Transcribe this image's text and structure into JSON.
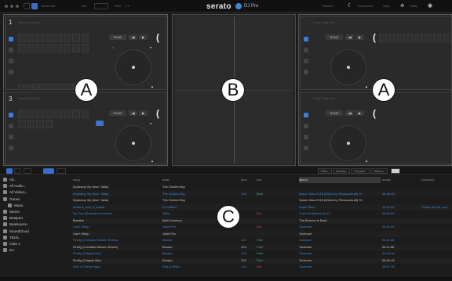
{
  "app": {
    "logo": "serato",
    "logo_suffix": "DJ Pro"
  },
  "topbar": {
    "mode_label": "Horizontal",
    "items": [
      "Link",
      "REC",
      "FX"
    ],
    "right_items": [
      "Practice",
      "Exclusions",
      "Help",
      "Setup"
    ]
  },
  "decks": {
    "left_top": {
      "number": "1",
      "title": "Drag Song Here"
    },
    "left_bottom": {
      "number": "3",
      "title": "Drag Song Here"
    },
    "right_top": {
      "title": "Drag Song Here"
    },
    "right_bottom": {
      "title": "Drag Song Here"
    },
    "sync_label": "SYNC",
    "play_glyph": "▶",
    "cue_glyph": "|◀",
    "x_glyph": "✕"
  },
  "labels": {
    "a_left": "A",
    "b": "B",
    "a_right": "A",
    "c": "C"
  },
  "library": {
    "panel_tabs": [
      "Files",
      "Browse",
      "Prepare",
      "History"
    ],
    "sidebar": [
      {
        "label": "All...",
        "icon": "star-icon"
      },
      {
        "label": "All Audio...",
        "icon": "audio-icon"
      },
      {
        "label": "All Videos...",
        "icon": "video-icon"
      },
      {
        "label": "iTunes",
        "icon": "itunes-icon"
      },
      {
        "label": "Music",
        "icon": "music-icon"
      },
      {
        "label": "Stems",
        "icon": "stems-icon"
      },
      {
        "label": "Beatport",
        "icon": "beatport-icon"
      },
      {
        "label": "Beatsource",
        "icon": "beatsource-icon"
      },
      {
        "label": "SoundCloud",
        "icon": "soundcloud-icon"
      },
      {
        "label": "TIDAL",
        "icon": "tidal-icon"
      },
      {
        "label": "crate 1",
        "icon": "crate-icon"
      },
      {
        "label": "DA",
        "icon": "crate-icon"
      }
    ],
    "columns": [
      "song",
      "artist",
      "bpm",
      "key",
      "album",
      "length",
      "comment"
    ],
    "rows": [
      {
        "song": "Epiphany Vip (feat. Taliia)",
        "artist": "The Golden Boy",
        "bpm": "",
        "key": "",
        "album": "",
        "length": "",
        "comment": "",
        "color": "#c8c8c8"
      },
      {
        "song": "Epiphany Vip (feat. Taliia)",
        "artist": "The Golden Boy",
        "bpm": "124",
        "key": "Ebm",
        "album": "Space Ibiza 2015 (Mixed by Pleasurekraft) Te",
        "length": "05:48.45",
        "comment": "",
        "color": "#3a8be0"
      },
      {
        "song": "Epiphany Vip (feat. Taliia)",
        "artist": "The Golden Boy",
        "bpm": "",
        "key": "",
        "album": "Space Ibiza 2015 (Mixed by Pleasurekraft) Te",
        "length": "",
        "comment": "",
        "color": "#c8c8c8"
      },
      {
        "song": "seabird_solo_a_teaser",
        "artist": "DJ Gilbert",
        "bpm": "",
        "key": "",
        "album": "Super Best",
        "length": "12:19.84",
        "comment": "Thank you for your",
        "color": "#3a8be0"
      },
      {
        "song": "My Turn (Extended Version)",
        "artist": "Taliia",
        "bpm": "",
        "key": "Em",
        "album": "That's Enriched Vol.12",
        "length": "06:02.69",
        "comment": "",
        "color": "#3a8be0"
      },
      {
        "song": "Breathe",
        "artist": "Brett Johnson",
        "bpm": "",
        "key": "",
        "album": "The Bounce Is Back",
        "length": "",
        "comment": "",
        "color": "#c8c8c8"
      },
      {
        "song": "Can't Sleep",
        "artist": "Juliet Fox",
        "bpm": "",
        "key": "Dm",
        "album": "Toolroom",
        "length": "06:21.69",
        "comment": "",
        "color": "#3a8be0"
      },
      {
        "song": "Can't Sleep",
        "artist": "Juliet Fox",
        "bpm": "",
        "key": "",
        "album": "Toolroom",
        "length": "",
        "comment": "",
        "color": "#c8c8c8"
      },
      {
        "song": "Firefly (Christian Nielsen Remix)",
        "artist": "Bontan",
        "bpm": "124",
        "key": "F#m",
        "album": "Toolroom",
        "length": "06:11.85",
        "comment": "",
        "color": "#3a8be0"
      },
      {
        "song": "Firefly (Christian Nielsen Remix)",
        "artist": "Bontan",
        "bpm": "124",
        "key": "F#m",
        "album": "Toolroom",
        "length": "06:11.85",
        "comment": "",
        "color": "#c8c8c8"
      },
      {
        "song": "Firefly (Original Mix)",
        "artist": "Bontan",
        "bpm": "123",
        "key": "F#m",
        "album": "Toolroom",
        "length": "06:06.18",
        "comment": "",
        "color": "#3a8be0"
      },
      {
        "song": "Firefly (Original Mix)",
        "artist": "Bontan",
        "bpm": "123",
        "key": "F#m",
        "album": "Toolroom",
        "length": "06:06.18",
        "comment": "",
        "color": "#c8c8c8"
      },
      {
        "song": "One of These Days",
        "artist": "Pink & Ritch",
        "bpm": "124",
        "key": "Dm",
        "album": "Toolroom",
        "length": "05:57.15",
        "comment": "",
        "color": "#3a8be0"
      }
    ]
  },
  "colors": {
    "accent": "#3a7fe0",
    "key_red": "#d24a4a",
    "key_green": "#3bbf6f"
  }
}
